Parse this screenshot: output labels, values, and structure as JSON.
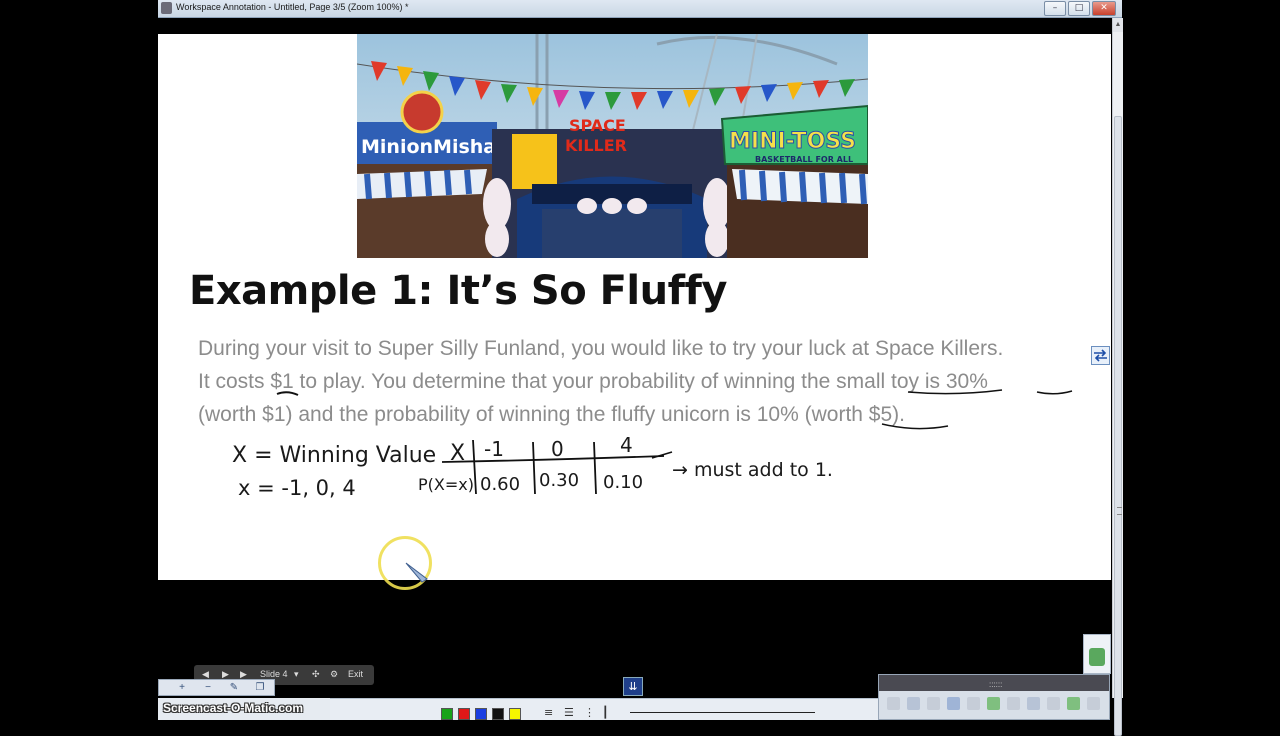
{
  "window": {
    "title": "Workspace Annotation - Untitled, Page 3/5  (Zoom 100%) *",
    "min_label": "–",
    "max_label": "□",
    "close_label": "✕"
  },
  "photo": {
    "sign_left": "MinionMishap",
    "sign_center_top": "SPACE",
    "sign_center_bottom": "KILLER",
    "sign_right": "MINI-TOSS",
    "sign_right_sub": "BASKETBALL FOR ALL"
  },
  "slide": {
    "heading": "Example 1: It’s So Fluffy",
    "paragraph_lines": [
      "During your visit to Super Silly Funland, you would like to try your luck at Space Killers.",
      "It costs $1 to play.  You determine that your probability of winning the small toy is 30%",
      "(worth $1) and the probability of winning the fluffy unicorn is 10% (worth $5)."
    ]
  },
  "handwriting": {
    "def_line": "X = Winning Value",
    "values_line": "x = -1, 0, 4",
    "table_x_label": "X",
    "table_p_label": "P(X=x)",
    "table_x_values": [
      "-1",
      "0",
      "4"
    ],
    "table_p_values": [
      "0.60",
      "0.30",
      "0.10"
    ],
    "note": "→ must add to 1."
  },
  "player": {
    "slide_label": "Slide 4",
    "exit_label": "Exit",
    "brand": "Screencast-O-Matic.com"
  },
  "colors": {
    "swatches": [
      "#1aa31a",
      "#e01818",
      "#1a3ee0",
      "#111111",
      "#f5f500"
    ]
  }
}
